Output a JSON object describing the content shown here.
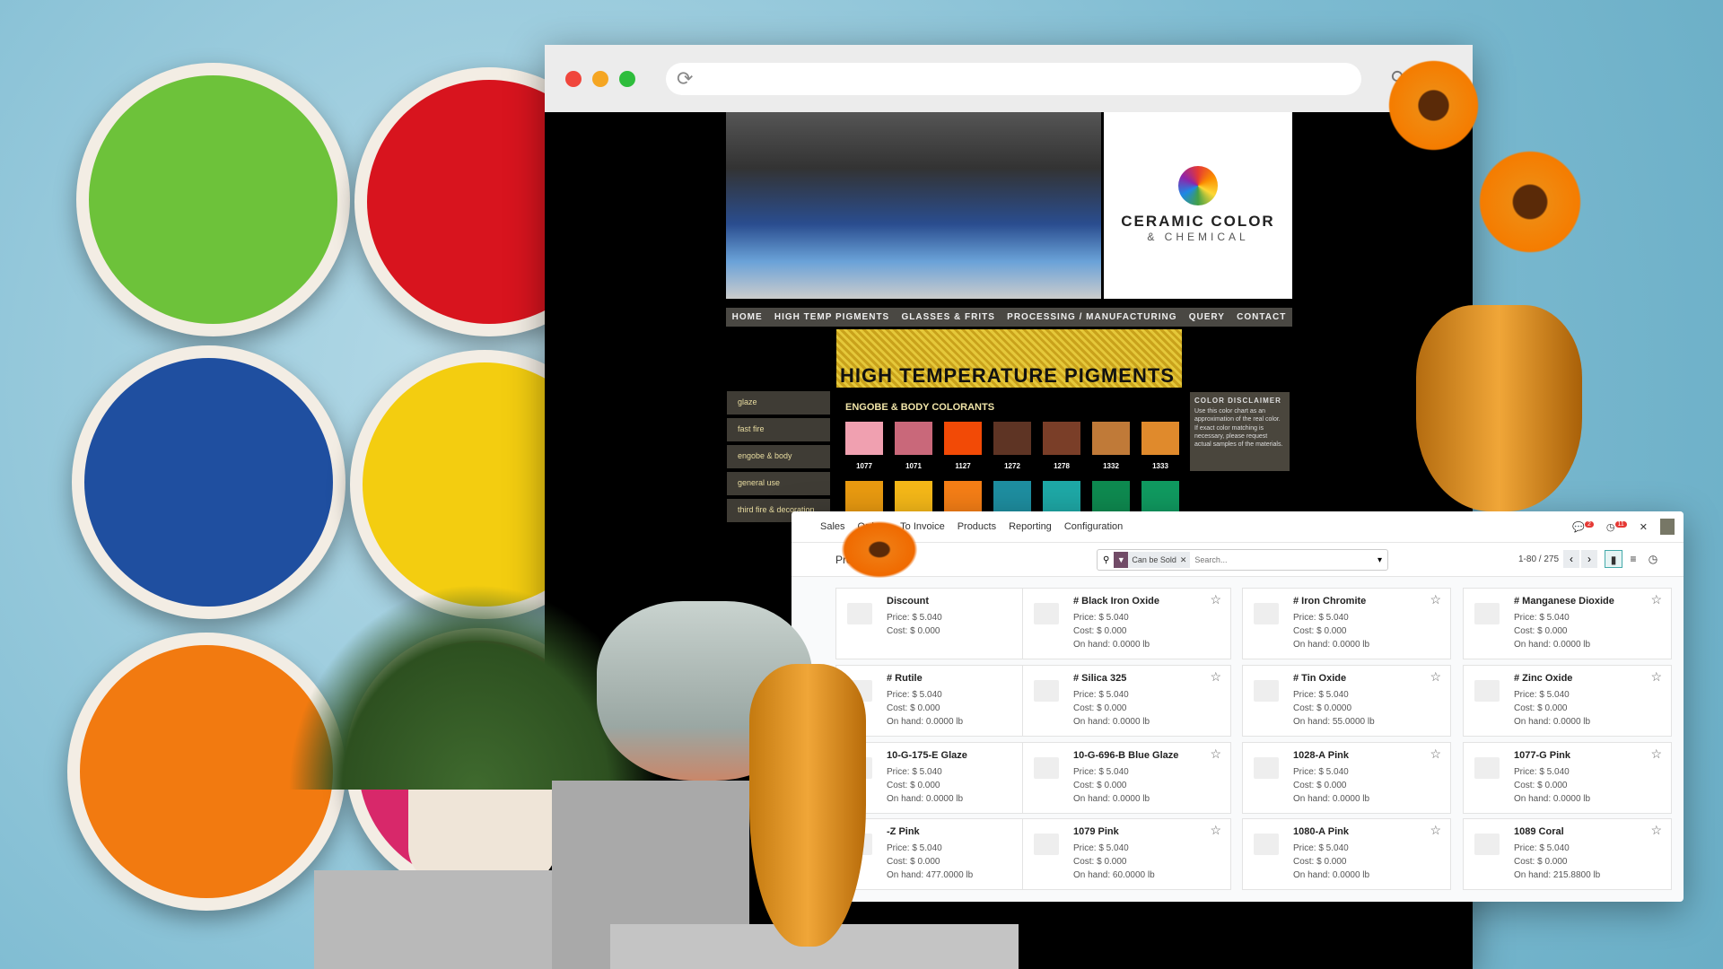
{
  "browser": {
    "url": ""
  },
  "site": {
    "logo": {
      "line1": "CERAMIC COLOR",
      "line2": "& CHEMICAL"
    },
    "nav": [
      "HOME",
      "HIGH TEMP PIGMENTS",
      "GLASSES & FRITS",
      "PROCESSING / MANUFACTURING",
      "QUERY",
      "CONTACT"
    ],
    "banner": "HIGH TEMPERATURE PIGMENTS",
    "side_menu": [
      "glaze",
      "fast fire",
      "engobe & body",
      "general use",
      "third fire & decoration"
    ],
    "section_title": "ENGOBE & BODY COLORANTS",
    "swatches": [
      {
        "code": "1077",
        "color": "#f0a0b0"
      },
      {
        "code": "1071",
        "color": "#c9687a"
      },
      {
        "code": "1127",
        "color": "#f24a06"
      },
      {
        "code": "1272",
        "color": "#5e3424"
      },
      {
        "code": "1278",
        "color": "#7a3e28"
      },
      {
        "code": "1332",
        "color": "#c07a38"
      },
      {
        "code": "1333",
        "color": "#e08a2c"
      }
    ],
    "swatches_row2": [
      "#e99a10",
      "#f5b818",
      "#f57e16",
      "#1e8ea0",
      "#1ea8a6",
      "#0e8a50",
      "#109a60"
    ],
    "disclaimer": {
      "title": "COLOR DISCLAIMER",
      "text": "Use this color chart as an approximation of the real color. If exact color matching is necessary, please request actual samples of the materials."
    }
  },
  "odoo": {
    "menu": [
      "Sales",
      "Orders",
      "To Invoice",
      "Products",
      "Reporting",
      "Configuration"
    ],
    "badges": {
      "messages": "2",
      "activities": "11"
    },
    "breadcrumb": "Products",
    "filter": "Can be Sold",
    "search_placeholder": "Search...",
    "pager": "1-80 / 275",
    "products": [
      {
        "name": "Discount",
        "price": "Price: $ 5.040",
        "cost": "Cost: $ 0.000",
        "onhand": "",
        "favorite": true
      },
      {
        "name": "# Black Iron Oxide",
        "price": "Price: $ 5.040",
        "cost": "Cost: $ 0.000",
        "onhand": "On hand: 0.0000 lb",
        "favorite": false
      },
      {
        "name": "# Iron Chromite",
        "price": "Price: $ 5.040",
        "cost": "Cost: $ 0.000",
        "onhand": "On hand: 0.0000 lb",
        "favorite": false
      },
      {
        "name": "# Manganese Dioxide",
        "price": "Price: $ 5.040",
        "cost": "Cost: $ 0.000",
        "onhand": "On hand: 0.0000 lb",
        "favorite": false
      },
      {
        "name": "# Rutile",
        "price": "Price: $ 5.040",
        "cost": "Cost: $ 0.000",
        "onhand": "On hand: 0.0000 lb",
        "favorite": false
      },
      {
        "name": "# Silica 325",
        "price": "Price: $ 5.040",
        "cost": "Cost: $ 0.000",
        "onhand": "On hand: 0.0000 lb",
        "favorite": false
      },
      {
        "name": "# Tin Oxide",
        "price": "Price: $ 5.040",
        "cost": "Cost: $ 0.0000",
        "onhand": "On hand: 55.0000 lb",
        "favorite": false
      },
      {
        "name": "# Zinc Oxide",
        "price": "Price: $ 5.040",
        "cost": "Cost: $ 0.000",
        "onhand": "On hand: 0.0000 lb",
        "favorite": false
      },
      {
        "name": "10-G-175-E Glaze",
        "price": "Price: $ 5.040",
        "cost": "Cost: $ 0.000",
        "onhand": "On hand: 0.0000 lb",
        "favorite": false
      },
      {
        "name": "10-G-696-B Blue Glaze",
        "price": "Price: $ 5.040",
        "cost": "Cost: $ 0.000",
        "onhand": "On hand: 0.0000 lb",
        "favorite": false
      },
      {
        "name": "1028-A Pink",
        "price": "Price: $ 5.040",
        "cost": "Cost: $ 0.000",
        "onhand": "On hand: 0.0000 lb",
        "favorite": false
      },
      {
        "name": "1077-G Pink",
        "price": "Price: $ 5.040",
        "cost": "Cost: $ 0.000",
        "onhand": "On hand: 0.0000 lb",
        "favorite": false
      },
      {
        "name": "-Z Pink",
        "price": "Price: $ 5.040",
        "cost": "Cost: $ 0.000",
        "onhand": "On hand: 477.0000 lb",
        "favorite": false
      },
      {
        "name": "1079 Pink",
        "price": "Price: $ 5.040",
        "cost": "Cost: $ 0.000",
        "onhand": "On hand: 60.0000 lb",
        "favorite": false
      },
      {
        "name": "1080-A Pink",
        "price": "Price: $ 5.040",
        "cost": "Cost: $ 0.000",
        "onhand": "On hand: 0.0000 lb",
        "favorite": false
      },
      {
        "name": "1089 Coral",
        "price": "Price: $ 5.040",
        "cost": "Cost: $ 0.000",
        "onhand": "On hand: 215.8800 lb",
        "favorite": false
      }
    ]
  },
  "colors": {
    "odoo_brand": "#714b67",
    "favorite_star": "#f3b400"
  }
}
